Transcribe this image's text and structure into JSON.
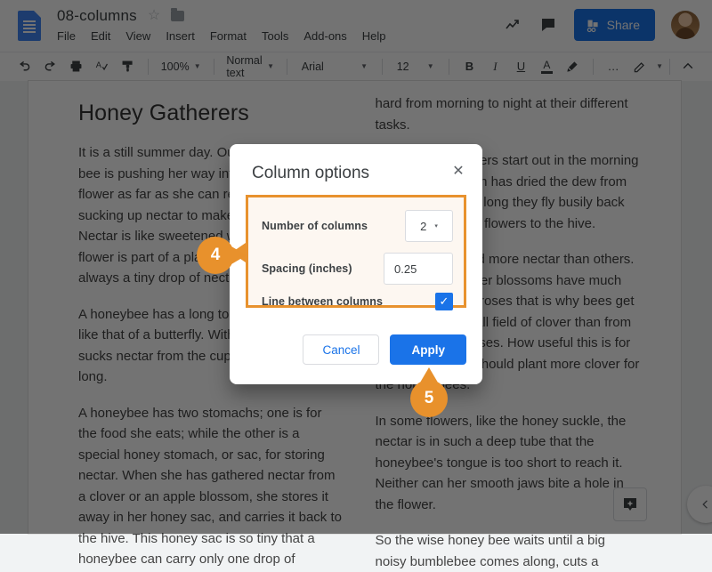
{
  "header": {
    "doc_icon": "google-docs-icon",
    "title": "08-columns",
    "star_icon": "☆",
    "folder_icon": "folder-icon",
    "menu": [
      "File",
      "Edit",
      "View",
      "Insert",
      "Format",
      "Tools",
      "Add-ons",
      "Help"
    ],
    "activity_icon": "activity-trend-icon",
    "comment_icon": "comment-icon",
    "share_label": "Share",
    "share_color": "#1a73e8",
    "avatar": "user-avatar"
  },
  "toolbar": {
    "undo": "↶",
    "redo": "↷",
    "print": "print-icon",
    "spelling": "spell-check-icon",
    "paint_format": "paint-format-icon",
    "zoom_value": "100%",
    "style_value": "Normal text",
    "font_value": "Arial",
    "size_value": "12",
    "bold": "B",
    "italic": "I",
    "underline": "U",
    "text_color": "A",
    "highlight": "highlighter-icon",
    "more": "…",
    "edit_mode": "pencil-icon",
    "collapse": "^"
  },
  "document": {
    "heading": "Honey Gatherers",
    "left_column": [
      "It is a still summer day. Out in the meadow a bee is pushing her way into the cup of a flower as far as she can reach. She is sucking up nectar to make into honey. Nectar is like sweetened water, and when a flower is part of a plant or tree there is always a tiny drop of nectar in it.",
      "A honeybee has a long tongue, something like that of a butterfly. With this tongue she sucks nectar from the cups of flowers all day long.",
      "A honeybee has two stomachs; one is for the food she eats; while the other is a special honey stomach, or sac, for storing nectar. When she has gathered nectar from a clover or an apple blossom, she stores it away in her honey sac, and carries it back to the hive. This honey sac is so tiny that a honeybee can carry only one drop of"
    ],
    "right_column": [
      "hard from morning to night at their different tasks.",
      "The honey gatherers start out in the morning as soon as the sun has dried the dew from the plants. All day long they fly busily back and forth from the flowers to the hive.",
      "Some flowers hold more nectar than others. For example, clover blossoms have much more nectar than roses that is why bees get nectar from a small field of clover than from a garden full of roses. How useful this is for the bees! So we should plant more clover for the honey bees.",
      "In some flowers, like the honey suckle, the nectar is in such a deep tube that the honeybee's tongue is too short to reach it. Neither can her smooth jaws bite a hole in the flower.",
      "So the wise honey bee waits until a big noisy bumblebee comes along, cuts a"
    ],
    "explore_icon": "explore-icon",
    "sidebar_toggle_icon": "chevron-left-icon"
  },
  "dialog": {
    "title": "Column options",
    "close_icon": "✕",
    "fields": {
      "columns_label": "Number of columns",
      "columns_value": "2",
      "columns_caret": "▾",
      "spacing_label": "Spacing (inches)",
      "spacing_value": "0.25",
      "line_label": "Line between columns",
      "line_checked_icon": "✓"
    },
    "cancel_label": "Cancel",
    "apply_label": "Apply",
    "highlight_color": "#e8922e",
    "accent_color": "#1a73e8"
  },
  "callouts": [
    {
      "number": "4",
      "points": "right"
    },
    {
      "number": "5",
      "points": "up"
    }
  ]
}
